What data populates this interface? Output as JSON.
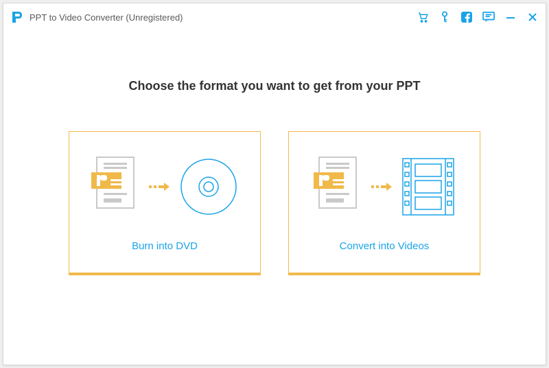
{
  "window": {
    "title": "PPT to Video Converter (Unregistered)"
  },
  "main": {
    "heading": "Choose the format you want to get from your PPT",
    "options": {
      "dvd": {
        "label": "Burn into DVD"
      },
      "video": {
        "label": "Convert into Videos"
      }
    }
  },
  "colors": {
    "accent_blue": "#1aa3e8",
    "accent_orange": "#f0b94a"
  }
}
